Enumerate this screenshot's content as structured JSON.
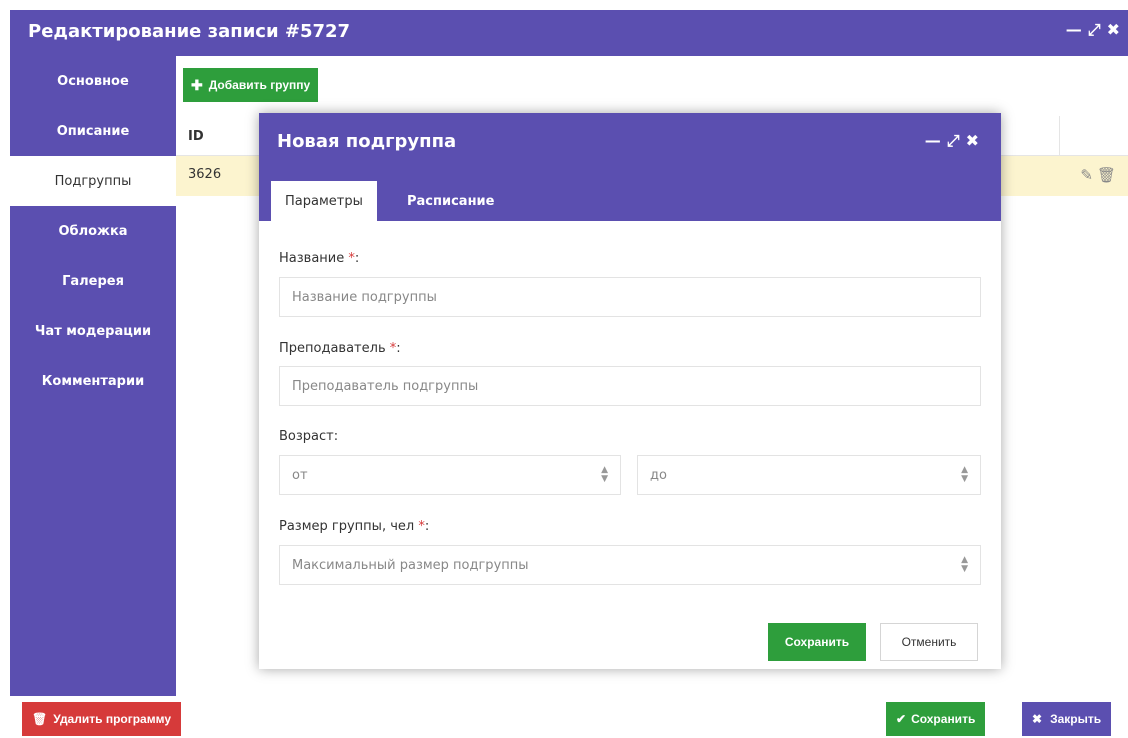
{
  "window": {
    "title": "Редактирование записи #5727",
    "controls": [
      "minimize-icon",
      "maximize-icon",
      "close-icon"
    ]
  },
  "sidebar": {
    "items": [
      {
        "label": "Основное",
        "active": false
      },
      {
        "label": "Описание",
        "active": false
      },
      {
        "label": "Подгруппы",
        "active": true
      },
      {
        "label": "Обложка",
        "active": false
      },
      {
        "label": "Галерея",
        "active": false
      },
      {
        "label": "Чат модерации",
        "active": false
      },
      {
        "label": "Комментарии",
        "active": false
      }
    ]
  },
  "main": {
    "add_group_label": "Добавить группу",
    "table": {
      "headers": [
        "ID"
      ],
      "rows": [
        {
          "id": "3626"
        }
      ]
    }
  },
  "footer": {
    "delete_label": "Удалить программу",
    "save_label": "Сохранить",
    "close_label": "Закрыть"
  },
  "modal": {
    "title": "Новая подгруппа",
    "tabs": [
      {
        "label": "Параметры",
        "active": true
      },
      {
        "label": "Расписание",
        "active": false
      }
    ],
    "fields": {
      "name": {
        "label": "Название",
        "required_mark": "*",
        "suffix": ":",
        "placeholder": "Название подгруппы"
      },
      "teacher": {
        "label": "Преподаватель",
        "required_mark": "*",
        "suffix": ":",
        "placeholder": "Преподаватель подгруппы"
      },
      "age": {
        "label": "Возраст:",
        "from_placeholder": "от",
        "to_placeholder": "до"
      },
      "size": {
        "label": "Размер группы, чел",
        "required_mark": "*",
        "suffix": ":",
        "placeholder": "Максимальный размер подгруппы"
      }
    },
    "save_label": "Сохранить",
    "cancel_label": "Отменить"
  },
  "colors": {
    "primary": "#5b4fb0",
    "success": "#2e9e3c",
    "danger": "#d63a3a",
    "row_highlight": "#fcf4cf"
  }
}
